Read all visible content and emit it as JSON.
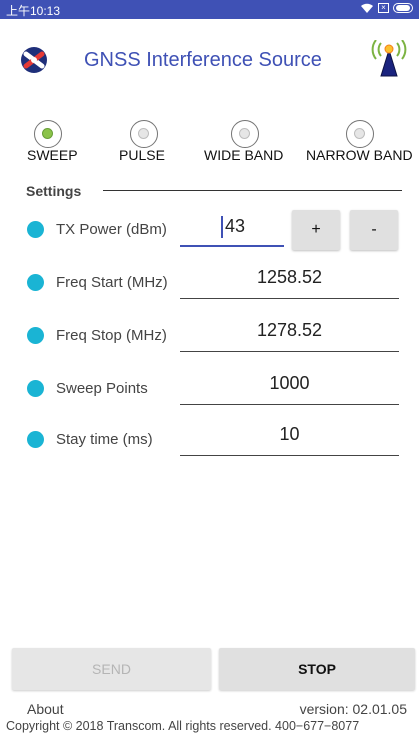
{
  "status_bar": {
    "time": "上午10:13",
    "icons": [
      "wifi-icon",
      "sim-icon",
      "battery-icon"
    ],
    "color": "#3f51b5"
  },
  "header": {
    "title": "GNSS Interference Source",
    "logo_icon": "transcom-logo",
    "antenna_icon": "antenna-signal-icon"
  },
  "modes": [
    {
      "label": "SWEEP",
      "selected": true
    },
    {
      "label": "PULSE",
      "selected": false
    },
    {
      "label": "WIDE BAND",
      "selected": false
    },
    {
      "label": "NARROW BAND",
      "selected": false
    }
  ],
  "settings": {
    "heading": "Settings",
    "tx_power": {
      "label": "TX Power (dBm)",
      "value": "43",
      "plus": "+",
      "minus": "-"
    },
    "freq_start": {
      "label": "Freq Start (MHz)",
      "value": "1258.52"
    },
    "freq_stop": {
      "label": "Freq Stop (MHz)",
      "value": "1278.52"
    },
    "sweep_points": {
      "label": "Sweep Points",
      "value": "1000"
    },
    "stay_time": {
      "label": "Stay time (ms)",
      "value": "10"
    }
  },
  "actions": {
    "send": "SEND",
    "stop": "STOP"
  },
  "footer": {
    "about": "About",
    "version": "version: 02.01.05",
    "copyright": "Copyright © 2018 Transcom. All rights reserved. 400−677−8077"
  },
  "colors": {
    "accent": "#3f51b5",
    "bullet": "#1ab4d4",
    "selected_radio": "#8bc34a"
  }
}
